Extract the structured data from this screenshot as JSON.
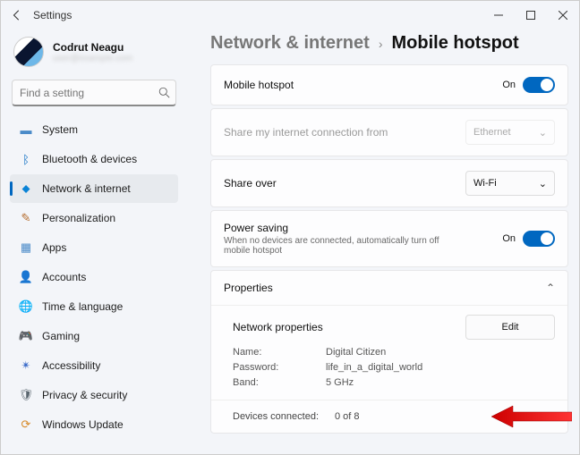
{
  "titlebar": {
    "title": "Settings"
  },
  "user": {
    "name": "Codrut Neagu",
    "email": "user@example.com"
  },
  "search": {
    "placeholder": "Find a setting"
  },
  "sidebar": {
    "items": [
      {
        "label": "System"
      },
      {
        "label": "Bluetooth & devices"
      },
      {
        "label": "Network & internet"
      },
      {
        "label": "Personalization"
      },
      {
        "label": "Apps"
      },
      {
        "label": "Accounts"
      },
      {
        "label": "Time & language"
      },
      {
        "label": "Gaming"
      },
      {
        "label": "Accessibility"
      },
      {
        "label": "Privacy & security"
      },
      {
        "label": "Windows Update"
      }
    ]
  },
  "breadcrumb": {
    "parent": "Network & internet",
    "current": "Mobile hotspot"
  },
  "rows": {
    "hotspot": {
      "label": "Mobile hotspot",
      "state": "On"
    },
    "sharefrom": {
      "label": "Share my internet connection from",
      "value": "Ethernet"
    },
    "shareover": {
      "label": "Share over",
      "value": "Wi-Fi"
    },
    "powersave": {
      "label": "Power saving",
      "sub": "When no devices are connected, automatically turn off mobile hotspot",
      "state": "On"
    }
  },
  "properties": {
    "header": "Properties",
    "section": "Network properties",
    "edit": "Edit",
    "name_k": "Name:",
    "name_v": "Digital Citizen",
    "pass_k": "Password:",
    "pass_v": "life_in_a_digital_world",
    "band_k": "Band:",
    "band_v": "5 GHz",
    "dev_k": "Devices connected:",
    "dev_v": "0 of 8"
  }
}
